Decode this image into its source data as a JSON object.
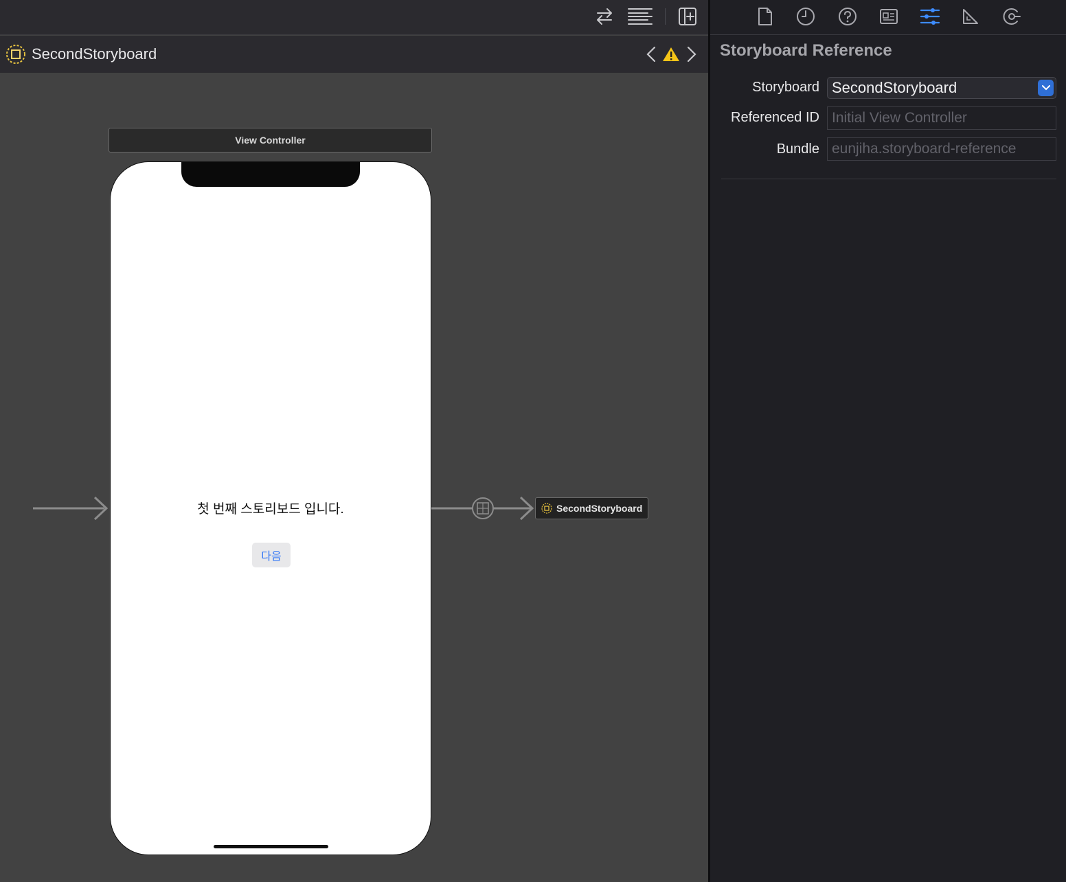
{
  "colors": {
    "canvas": "#424242",
    "chrome": "#2b2a2f",
    "inspector": "#1f1f24",
    "accent": "#3d8bff",
    "warning": "#f5c518",
    "button_text": "#3478f6"
  },
  "toolbar": {
    "icons": [
      "swap-arrows-icon",
      "editor-options-icon",
      "add-editor-icon"
    ]
  },
  "jumpbar": {
    "title": "SecondStoryboard",
    "icon": "storyboard-reference-icon",
    "warning_icon": "warning-icon"
  },
  "canvas": {
    "scene_title": "View Controller",
    "label_text": "첫 번째 스토리보드 입니다.",
    "button_text": "다음",
    "reference_node_label": "SecondStoryboard"
  },
  "inspector": {
    "tabs": [
      {
        "name": "file-inspector-icon",
        "active": false
      },
      {
        "name": "history-inspector-icon",
        "active": false
      },
      {
        "name": "quick-help-icon",
        "active": false
      },
      {
        "name": "identity-inspector-icon",
        "active": false
      },
      {
        "name": "attributes-inspector-icon",
        "active": true
      },
      {
        "name": "size-inspector-icon",
        "active": false
      },
      {
        "name": "connections-inspector-icon",
        "active": false
      }
    ],
    "section_title": "Storyboard Reference",
    "storyboard_label": "Storyboard",
    "storyboard_value": "SecondStoryboard",
    "referenced_id_label": "Referenced ID",
    "referenced_id_placeholder": "Initial View Controller",
    "bundle_label": "Bundle",
    "bundle_placeholder": "eunjiha.storyboard-reference"
  }
}
